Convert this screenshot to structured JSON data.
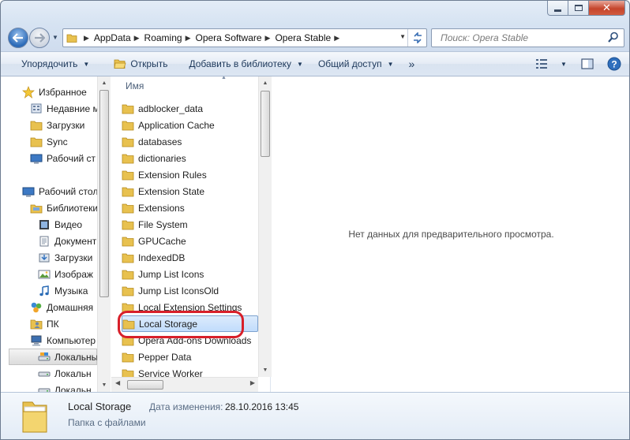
{
  "window": {
    "close_glyph": "✕"
  },
  "address": {
    "breadcrumbs": [
      "AppData",
      "Roaming",
      "Opera Software",
      "Opera Stable"
    ]
  },
  "search": {
    "placeholder": "Поиск: Opera Stable"
  },
  "toolbar": {
    "organize": "Упорядочить",
    "open": "Открыть",
    "add_to_library": "Добавить в библиотеку",
    "share": "Общий доступ",
    "more": "»"
  },
  "nav": {
    "items": [
      {
        "label": "Избранное",
        "icon": "star-icon"
      },
      {
        "label": "Недавние м",
        "icon": "recent-places-icon"
      },
      {
        "label": "Загрузки",
        "icon": "folder-icon"
      },
      {
        "label": "Sync",
        "icon": "folder-icon"
      },
      {
        "label": "Рабочий ст",
        "icon": "desktop-icon"
      },
      {
        "label": "Рабочий стол",
        "icon": "desktop-icon"
      },
      {
        "label": "Библиотеки",
        "icon": "libraries-icon"
      },
      {
        "label": "Видео",
        "icon": "video-library-icon"
      },
      {
        "label": "Документ",
        "icon": "documents-library-icon"
      },
      {
        "label": "Загрузки",
        "icon": "downloads-library-icon"
      },
      {
        "label": "Изображ",
        "icon": "pictures-library-icon"
      },
      {
        "label": "Музыка",
        "icon": "music-library-icon"
      },
      {
        "label": "Домашняя",
        "icon": "homegroup-icon"
      },
      {
        "label": "ПК",
        "icon": "user-folder-icon"
      },
      {
        "label": "Компьютер",
        "icon": "computer-icon"
      },
      {
        "label": "Локальны",
        "icon": "system-drive-icon"
      },
      {
        "label": "Локальн",
        "icon": "drive-icon"
      },
      {
        "label": "Локальн",
        "icon": "drive-icon"
      }
    ]
  },
  "files": {
    "column_header": "Имя",
    "items": [
      "adblocker_data",
      "Application Cache",
      "databases",
      "dictionaries",
      "Extension Rules",
      "Extension State",
      "Extensions",
      "File System",
      "GPUCache",
      "IndexedDB",
      "Jump List Icons",
      "Jump List IconsOld",
      "Local Extension Settings",
      "Local Storage",
      "Opera Add-ons Downloads",
      "Pepper Data",
      "Service Worker"
    ],
    "selected": "Local Storage"
  },
  "preview": {
    "message": "Нет данных для предварительного просмотра."
  },
  "details": {
    "name": "Local Storage",
    "type": "Папка с файлами",
    "modified_label": "Дата изменения:",
    "modified_value": "28.10.2016 13:45"
  },
  "colors": {
    "highlight_ring": "#d8202a",
    "selection": "#c1dcfc",
    "folder": "#e8c14f"
  }
}
